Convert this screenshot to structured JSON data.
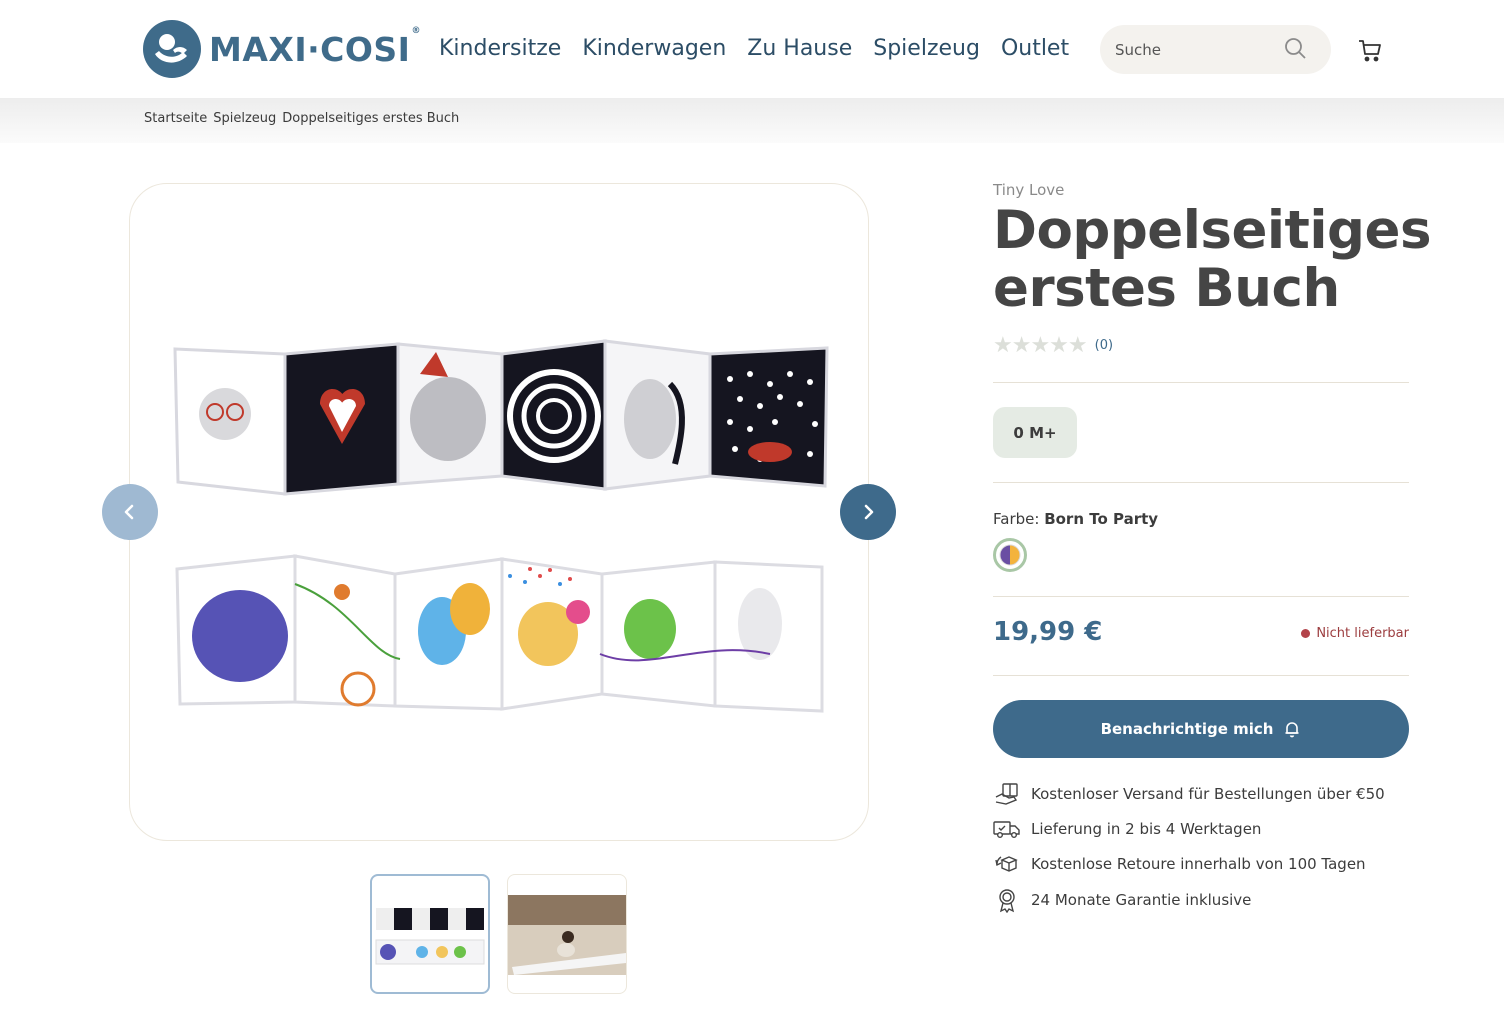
{
  "header": {
    "logo_text": "MAXI·COSI",
    "logo_reg": "®",
    "nav": [
      "Kindersitze",
      "Kinderwagen",
      "Zu Hause",
      "Spielzeug",
      "Outlet"
    ],
    "search_placeholder": "Suche",
    "icons": {
      "search": "search-icon",
      "cart": "cart-icon"
    }
  },
  "breadcrumb": [
    "Startseite",
    "Spielzeug",
    "Doppelseitiges erstes Buch"
  ],
  "gallery": {
    "thumbnail_count": 2,
    "selected_thumbnail": 1
  },
  "product": {
    "brand": "Tiny Love",
    "title": "Doppelseitiges erstes Buch",
    "rating_stars": "★★★★★",
    "rating_value": 0,
    "rating_count": "(0)",
    "age": "0 M+",
    "color_label": "Farbe: ",
    "color_value": "Born To Party",
    "price": "19,99 €",
    "stock": "Nicht lieferbar",
    "notify_button": "Benachrichtige mich"
  },
  "usps": [
    {
      "icon": "shipping-gift-icon",
      "text": "Kostenloser Versand für Bestellungen über €50"
    },
    {
      "icon": "delivery-truck-icon",
      "text": "Lieferung in 2 bis 4 Werktagen"
    },
    {
      "icon": "return-box-icon",
      "text": "Kostenlose Retoure innerhalb von 100 Tagen"
    },
    {
      "icon": "warranty-badge-icon",
      "text": "24 Monate Garantie inklusive"
    }
  ],
  "colors": {
    "brand_blue": "#3e6a8b",
    "light_blue": "#9fb9d2",
    "stock_red": "#b3434a",
    "age_bg": "#e5ebe4"
  }
}
